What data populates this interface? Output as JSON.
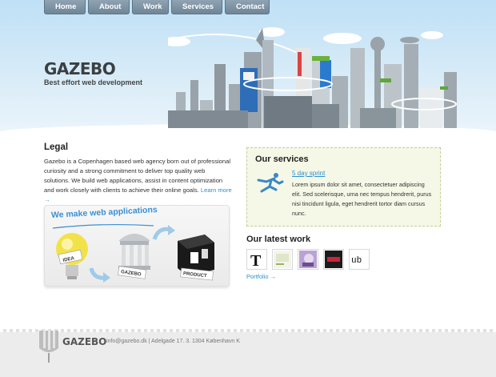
{
  "nav": {
    "items": [
      {
        "label": "Home"
      },
      {
        "label": "About"
      },
      {
        "label": "Work"
      },
      {
        "label": "Services"
      },
      {
        "label": "Contact"
      }
    ]
  },
  "header": {
    "logo": "GAZEBO",
    "tagline": "Best effort web development"
  },
  "legal": {
    "title": "Legal",
    "text": "Gazebo is a Copenhagen based web agency born out of professional curiosity and a strong commitment to deliver top quality web solutions. We build web applications, assist in content optimization and work closely with clients to achieve their online goals.",
    "more_link": "Learn more →"
  },
  "promo": {
    "title": "We make web applications",
    "labels": {
      "idea": "IDEA",
      "gazebo": "GAZEBO",
      "product": "PRODUCT"
    }
  },
  "services": {
    "title": "Our services",
    "item_title": "5 day sprint",
    "item_text": "Lorem ipsum dolor sit amet, consectetuer adipiscing elit. Sed scelerisque, urna nec tempus hendrerit, purus nisi tincidunt ligula, eget hendrerit tortor diam cursus nunc."
  },
  "work": {
    "title": "Our latest work",
    "portfolio_link": "Portfolio →",
    "thumbs": [
      "thumb-1",
      "thumb-2",
      "thumb-3",
      "thumb-4",
      "thumb-5"
    ],
    "thumb_texts": {
      "t1": "T",
      "t5": "ub"
    }
  },
  "footer": {
    "logo": "GAZEBO",
    "info": "info@gazebo.dk  |  Adelgade 17. 3. 1304 København K"
  },
  "colors": {
    "accent_blue": "#2f8fd0",
    "nav_gray": "#7d91a2",
    "sky": "#bfe0f6",
    "services_bg": "#f5f8e6"
  }
}
